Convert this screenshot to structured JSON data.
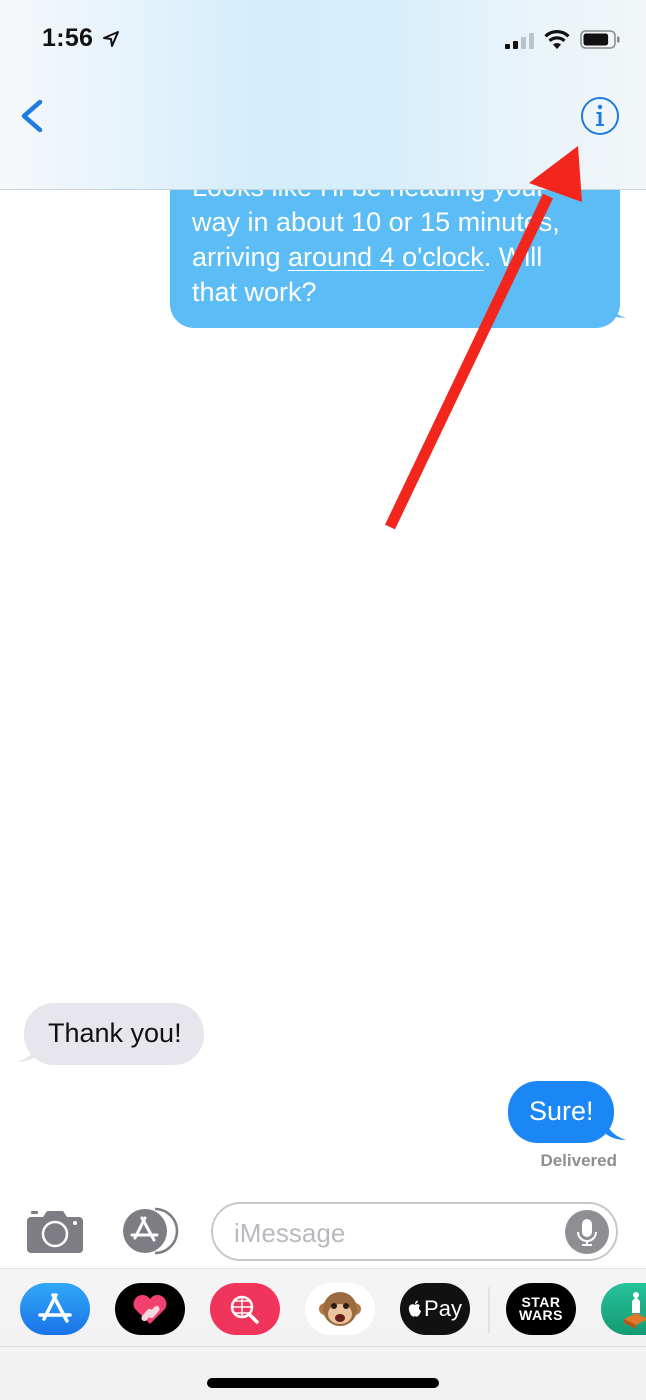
{
  "status_bar": {
    "time": "1:56",
    "location_icon": "location-arrow-icon",
    "signal_bars": 2,
    "signal_bars_total": 4,
    "wifi_icon": "wifi-icon",
    "battery_level": 0.85
  },
  "nav": {
    "back_icon": "chevron-left-icon",
    "info_icon": "info-circle-icon",
    "accent_color": "#1e7ce0"
  },
  "messages": [
    {
      "direction": "outgoing",
      "type": "sms",
      "hidden_first_line": "Looks like I'll be heading your",
      "line2": "way in about 10 or 15 minutes,",
      "line3_before": "arriving ",
      "line3_link": "around 4 o'clock",
      "line3_after": ". Will",
      "line4": "that work?",
      "color": "#5bbcf6"
    },
    {
      "direction": "incoming",
      "text": "Thank you!",
      "color": "#e6e6ec"
    },
    {
      "direction": "outgoing",
      "type": "imessage",
      "text": "Sure!",
      "status": "Delivered",
      "color": "#1b86f5"
    }
  ],
  "composer": {
    "camera_icon": "camera-icon",
    "apps_icon": "app-store-icon",
    "placeholder": "iMessage",
    "mic_icon": "microphone-icon"
  },
  "app_drawer": {
    "apps": [
      {
        "name": "App Store",
        "icon": "app-store-icon",
        "bg": "#2a8df0"
      },
      {
        "name": "Digital Touch",
        "icon": "heart-touch-icon",
        "bg": "#000000"
      },
      {
        "name": "Search Images",
        "icon": "globe-search-icon",
        "bg": "#f0355c"
      },
      {
        "name": "Animoji",
        "icon": "monkey-icon",
        "bg": "#ffffff"
      },
      {
        "name": "Apple Pay",
        "icon": "apple-pay-icon",
        "bg": "#111111",
        "label": "Pay"
      },
      {
        "name": "Star Wars",
        "icon": "star-wars-icon",
        "bg": "#000000",
        "label_top": "STAR",
        "label_bottom": "WARS"
      },
      {
        "name": "Monument Valley",
        "icon": "monument-valley-icon",
        "bg": "#23b98b"
      }
    ]
  },
  "annotation": {
    "type": "arrow",
    "color": "#f2261d",
    "points_to": "info-button"
  }
}
